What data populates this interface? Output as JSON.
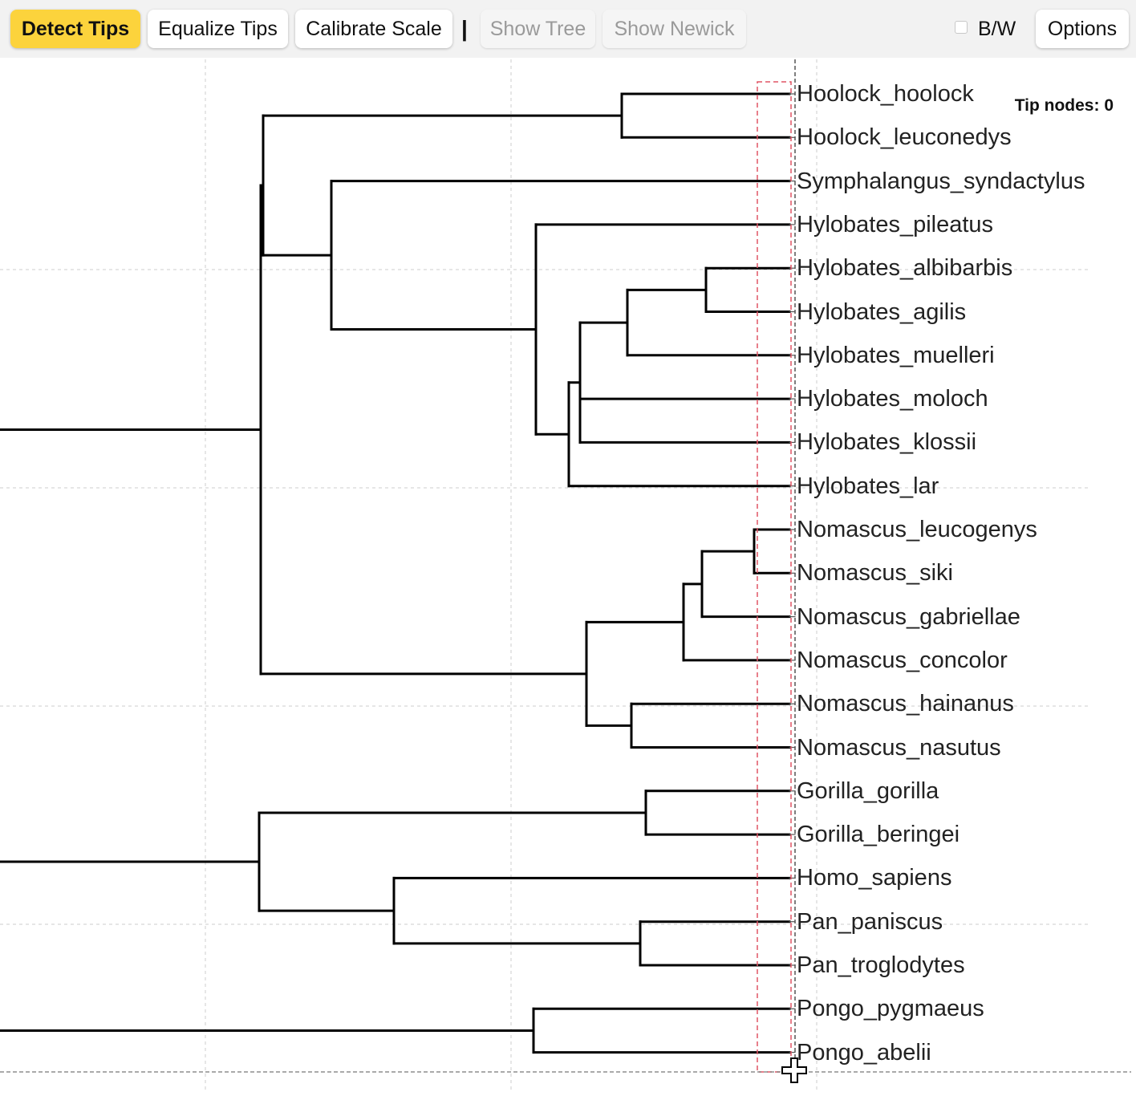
{
  "toolbar": {
    "detect_tips": "Detect Tips",
    "equalize_tips": "Equalize Tips",
    "calibrate_scale": "Calibrate Scale",
    "separator": "|",
    "show_tree": "Show Tree",
    "show_newick": "Show Newick",
    "bw_label": "B/W",
    "bw_checked": false,
    "options": "Options"
  },
  "status": {
    "tip_nodes": "Tip nodes: 0"
  },
  "colors": {
    "accent": "#fcd33c",
    "branch": "#000000",
    "tip_line": "#555555",
    "selection_box": "#e05565",
    "grid": "#cccccc"
  },
  "cursor_icon": "crosshair-plus-icon",
  "tips": [
    "Hoolock_hoolock",
    "Hoolock_leuconedys",
    "Symphalangus_syndactylus",
    "Hylobates_pileatus",
    "Hylobates_albibarbis",
    "Hylobates_agilis",
    "Hylobates_muelleri",
    "Hylobates_moloch",
    "Hylobates_klossii",
    "Hylobates_lar",
    "Nomascus_leucogenys",
    "Nomascus_siki",
    "Nomascus_gabriellae",
    "Nomascus_concolor",
    "Nomascus_hainanus",
    "Nomascus_nasutus",
    "Gorilla_gorilla",
    "Gorilla_beringei",
    "Homo_sapiens",
    "Pan_paniscus",
    "Pan_troglodytes",
    "Pongo_pygmaeus",
    "Pongo_abelii"
  ]
}
